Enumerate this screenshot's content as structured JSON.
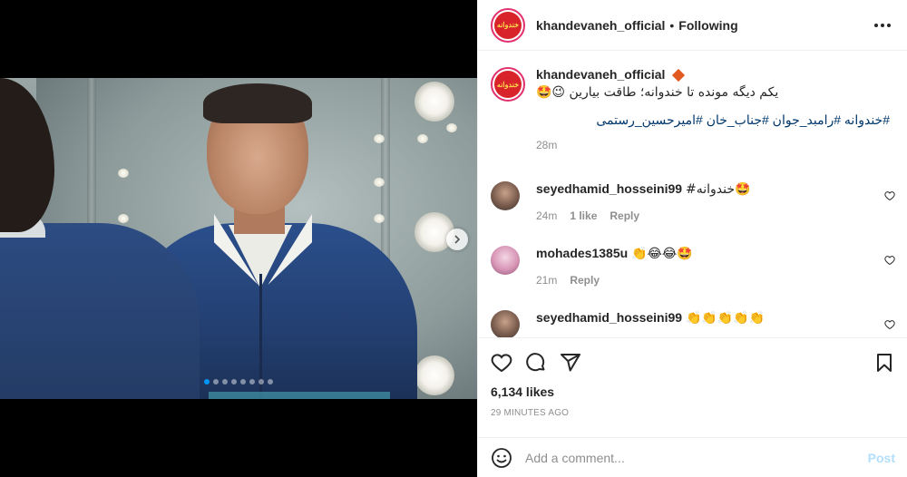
{
  "post": {
    "username": "khandevaneh_official",
    "follow_status": "Following",
    "separator": "•",
    "avatar_text": "خندوانه",
    "carousel": {
      "slides": 8,
      "active_index": 0
    }
  },
  "caption": {
    "username": "khandevaneh_official",
    "text": "یکم دیگه مونده تا خندوانه؛ طاقت بیارین 😉🤩",
    "hashtags": "#خندوانه #رامبد_جوان #جناب_خان #امیرحسین_رستمی",
    "time": "28m"
  },
  "comments": [
    {
      "username": "seyedhamid_hosseini99",
      "text": "#خندوانه🤩",
      "time": "24m",
      "likes": "1 like",
      "reply": "Reply"
    },
    {
      "username": "mohades1385u",
      "text": "👏😂😂🤩",
      "time": "21m",
      "reply": "Reply"
    },
    {
      "username": "seyedhamid_hosseini99",
      "text": "👏👏👏👏👏"
    }
  ],
  "actions": {
    "likes": "6,134 likes",
    "ago": "29 MINUTES AGO",
    "icons": [
      "heart-icon",
      "comment-icon",
      "share-icon",
      "bookmark-icon"
    ]
  },
  "add_comment": {
    "placeholder": "Add a comment...",
    "post_label": "Post"
  },
  "colors": {
    "link": "#00376b",
    "muted": "#8e8e8e",
    "post_disabled": "#b2dffc",
    "active_dot": "#0095f6"
  }
}
